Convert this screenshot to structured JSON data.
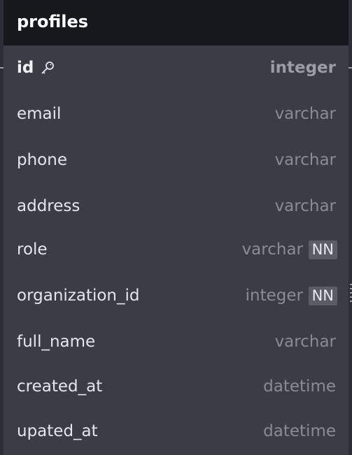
{
  "table": {
    "title": "profiles",
    "fields": [
      {
        "name": "id",
        "type": "integer",
        "primary_key": true,
        "badge": "",
        "icon": "key-icon"
      },
      {
        "name": "email",
        "type": "varchar",
        "primary_key": false,
        "badge": ""
      },
      {
        "name": "phone",
        "type": "varchar",
        "primary_key": false,
        "badge": ""
      },
      {
        "name": "address",
        "type": "varchar",
        "primary_key": false,
        "badge": ""
      },
      {
        "name": "role",
        "type": "varchar",
        "primary_key": false,
        "badge": "NN"
      },
      {
        "name": "organization_id",
        "type": "integer",
        "primary_key": false,
        "badge": "NN"
      },
      {
        "name": "full_name",
        "type": "varchar",
        "primary_key": false,
        "badge": ""
      },
      {
        "name": "created_at",
        "type": "datetime",
        "primary_key": false,
        "badge": ""
      },
      {
        "name": "upated_at",
        "type": "datetime",
        "primary_key": false,
        "badge": ""
      }
    ]
  },
  "colors": {
    "canvas": "#2d2e35",
    "card": "#3b3c44",
    "header": "#17181c",
    "badge": "#5c5d64"
  }
}
